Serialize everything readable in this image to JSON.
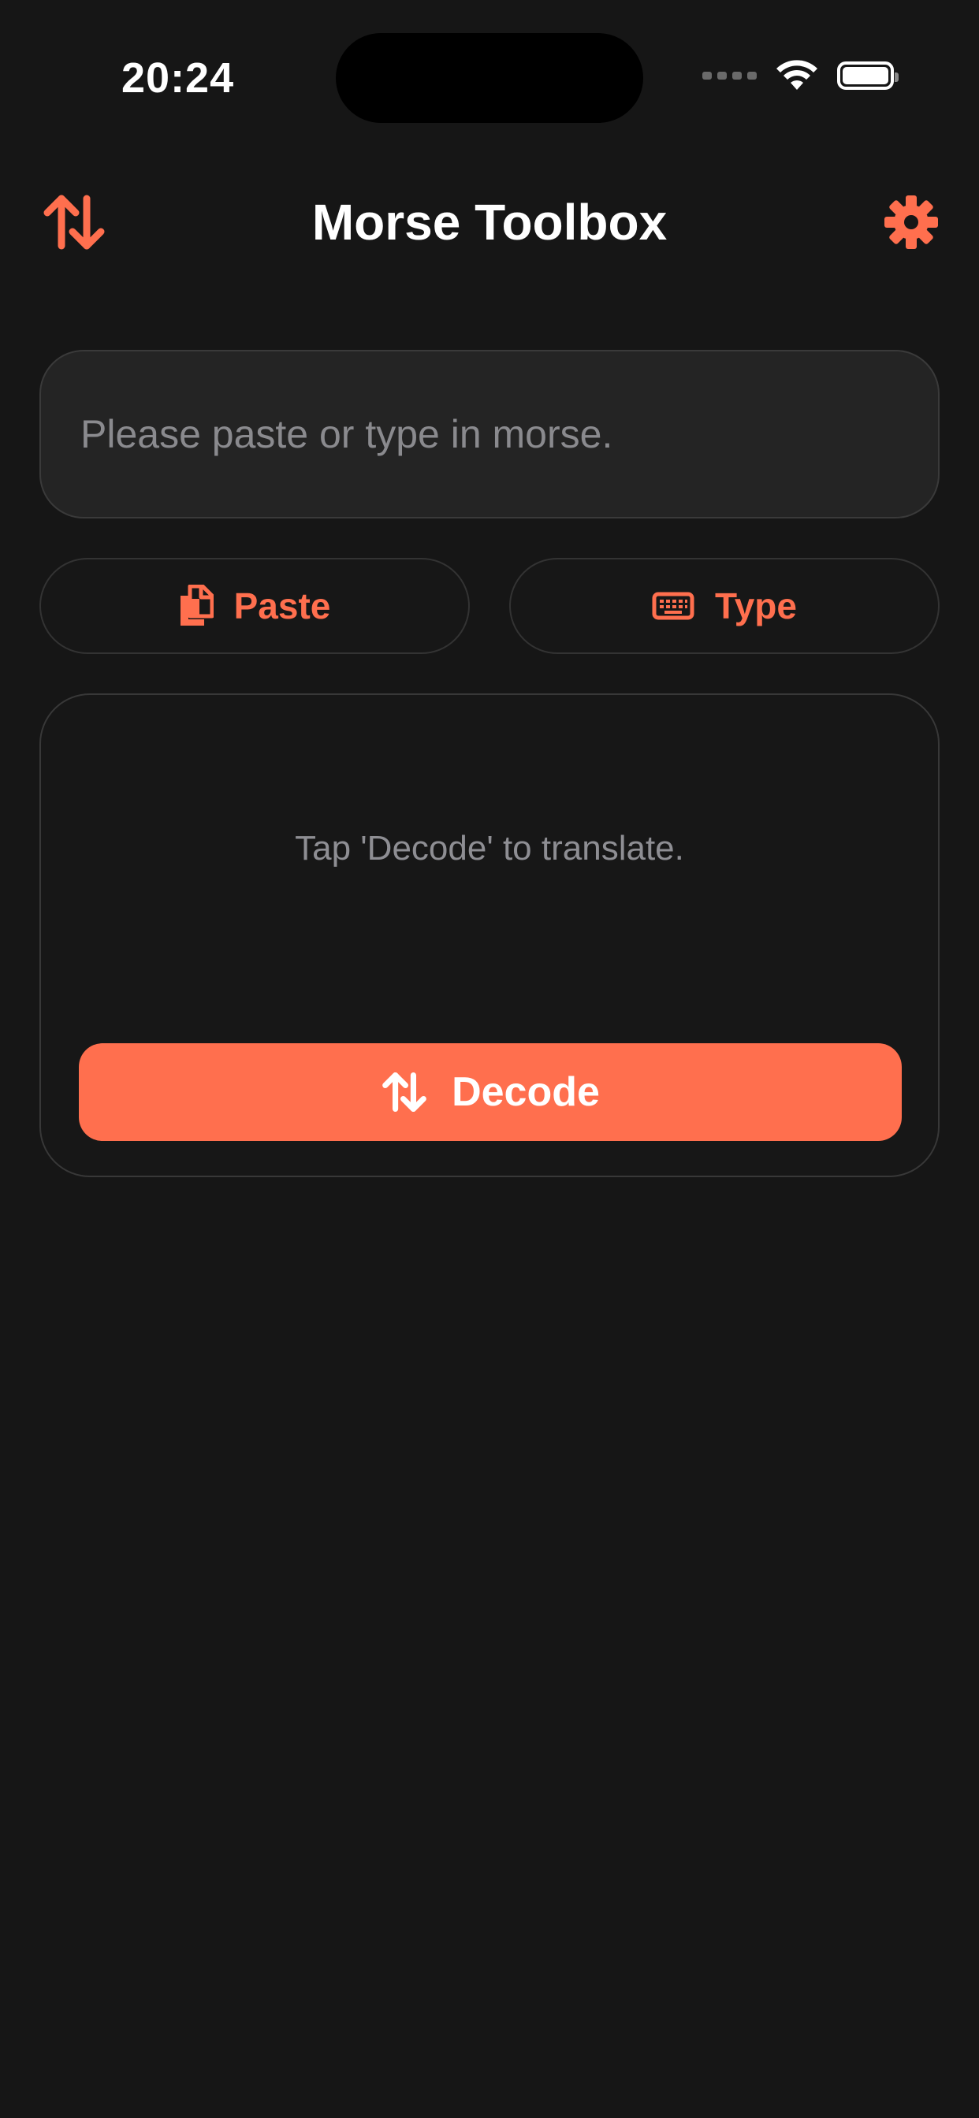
{
  "status_bar": {
    "time": "20:24"
  },
  "nav": {
    "title": "Morse Toolbox",
    "left_icon": "swap-arrows-icon",
    "right_icon": "gear-icon"
  },
  "input": {
    "placeholder": "Please paste or type in morse.",
    "value": ""
  },
  "actions": {
    "paste_label": "Paste",
    "paste_icon": "clipboard-copy-icon",
    "type_label": "Type",
    "type_icon": "keyboard-icon"
  },
  "result": {
    "hint": "Tap 'Decode' to translate.",
    "decode_label": "Decode",
    "decode_icon": "swap-arrows-icon"
  },
  "colors": {
    "accent": "#ff6f4e",
    "background": "#161616",
    "field": "#242424",
    "muted_text": "#8e8e93"
  }
}
